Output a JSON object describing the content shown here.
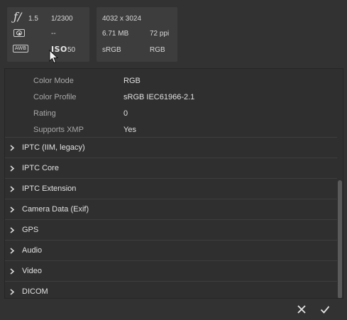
{
  "exposure": {
    "fstop_glyph": "ƒ/",
    "fstop_value": "1.5",
    "shutter": "1/2300",
    "metering_value": "--",
    "awb_label": "AWB",
    "iso_label": "ISO",
    "iso_value": "50"
  },
  "file_info": {
    "dimensions": "4032 x 3024",
    "size": "6.71 MB",
    "resolution": "72 ppi",
    "color_profile": "sRGB",
    "color_mode": "RGB"
  },
  "properties": [
    {
      "label": "Color Mode",
      "value": "RGB"
    },
    {
      "label": "Color Profile",
      "value": "sRGB IEC61966-2.1"
    },
    {
      "label": "Rating",
      "value": "0"
    },
    {
      "label": "Supports XMP",
      "value": "Yes"
    }
  ],
  "sections": [
    {
      "label": "IPTC (IIM, legacy)"
    },
    {
      "label": "IPTC Core"
    },
    {
      "label": "IPTC Extension"
    },
    {
      "label": "Camera Data (Exif)"
    },
    {
      "label": "GPS"
    },
    {
      "label": "Audio"
    },
    {
      "label": "Video"
    },
    {
      "label": "DICOM"
    }
  ],
  "footer": {
    "cancel_icon": "close-icon",
    "confirm_icon": "checkmark-icon"
  },
  "colors": {
    "background": "#323232",
    "card": "#3d3d3d",
    "panel": "#2f2f2f",
    "text": "#e2e2e2",
    "label_text": "#a8a8a8"
  }
}
